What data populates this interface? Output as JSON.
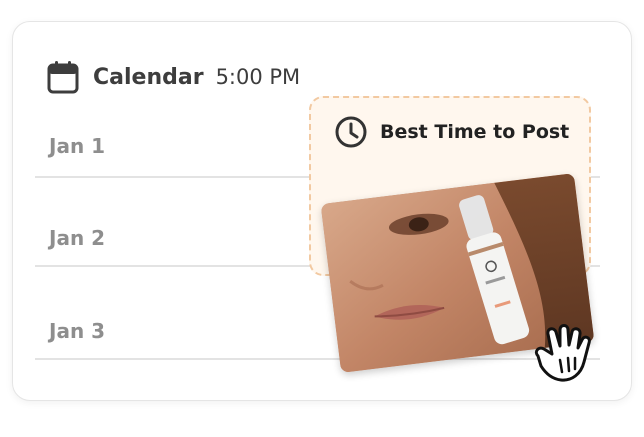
{
  "calendar": {
    "title": "Calendar",
    "time": "5:00 PM",
    "rows": [
      {
        "label": "Jan 1"
      },
      {
        "label": "Jan 2"
      },
      {
        "label": "Jan 3"
      }
    ]
  },
  "best_time": {
    "label": "Best Time to Post"
  },
  "photo": {
    "subject": "woman holding serum bottle"
  },
  "icons": {
    "calendar": "calendar-icon",
    "clock": "clock-icon",
    "cursor": "hand-pointer-icon"
  },
  "colors": {
    "text_dark": "#3d3d3d",
    "row_label": "#8e8e8e",
    "best_time_bg": "#fff7ee",
    "best_time_border": "#f2c9a1"
  }
}
